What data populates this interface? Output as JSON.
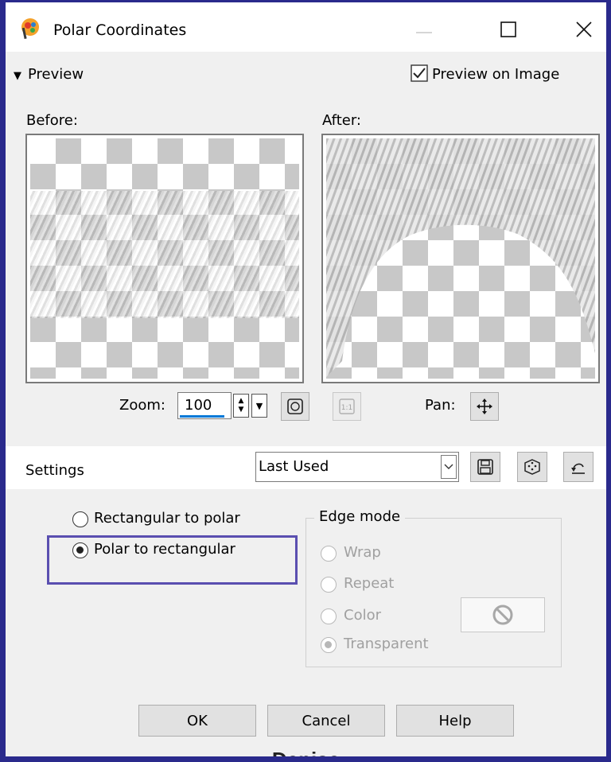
{
  "window": {
    "title": "Polar Coordinates"
  },
  "preview": {
    "section_label": "Preview",
    "preview_on_image_label": "Preview on Image",
    "preview_on_image_checked": true,
    "before_label": "Before:",
    "after_label": "After:",
    "zoom_label": "Zoom:",
    "zoom_value": "100",
    "pan_label": "Pan:"
  },
  "settings": {
    "label": "Settings",
    "preset_value": "Last Used"
  },
  "mode": {
    "options": [
      {
        "label": "Rectangular to polar",
        "selected": false
      },
      {
        "label": "Polar to rectangular",
        "selected": true
      }
    ]
  },
  "edge_mode": {
    "label": "Edge mode",
    "options": [
      {
        "label": "Wrap",
        "selected": false,
        "enabled": false
      },
      {
        "label": "Repeat",
        "selected": false,
        "enabled": false
      },
      {
        "label": "Color",
        "selected": false,
        "enabled": false
      },
      {
        "label": "Transparent",
        "selected": true,
        "enabled": false
      }
    ]
  },
  "buttons": {
    "ok": "OK",
    "cancel": "Cancel",
    "help": "Help"
  },
  "watermark": "Denise",
  "colors": {
    "frame": "#2a2a8c",
    "highlight_box": "#5a4fb0",
    "zoom_underline": "#0078d7"
  }
}
